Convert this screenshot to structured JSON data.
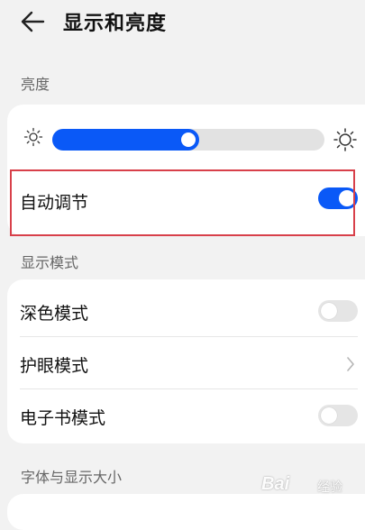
{
  "header": {
    "back_icon": "arrow-left-icon",
    "title": "显示和亮度"
  },
  "brightness": {
    "section_label": "亮度",
    "level": 0.5,
    "min_icon": "sun-small-icon",
    "max_icon": "sun-large-icon",
    "accent_color": "#0a59f7",
    "auto_adjust": {
      "label": "自动调节",
      "enabled": true
    }
  },
  "display_mode": {
    "section_label": "显示模式",
    "items": [
      {
        "label": "深色模式",
        "control": "toggle",
        "enabled": false
      },
      {
        "label": "护眼模式",
        "control": "chevron"
      },
      {
        "label": "电子书模式",
        "control": "toggle",
        "enabled": false
      }
    ]
  },
  "font": {
    "section_label": "字体与显示大小"
  },
  "watermark": {
    "text": "Bai",
    "suffix": "经验"
  },
  "highlight_color": "#d8404a"
}
